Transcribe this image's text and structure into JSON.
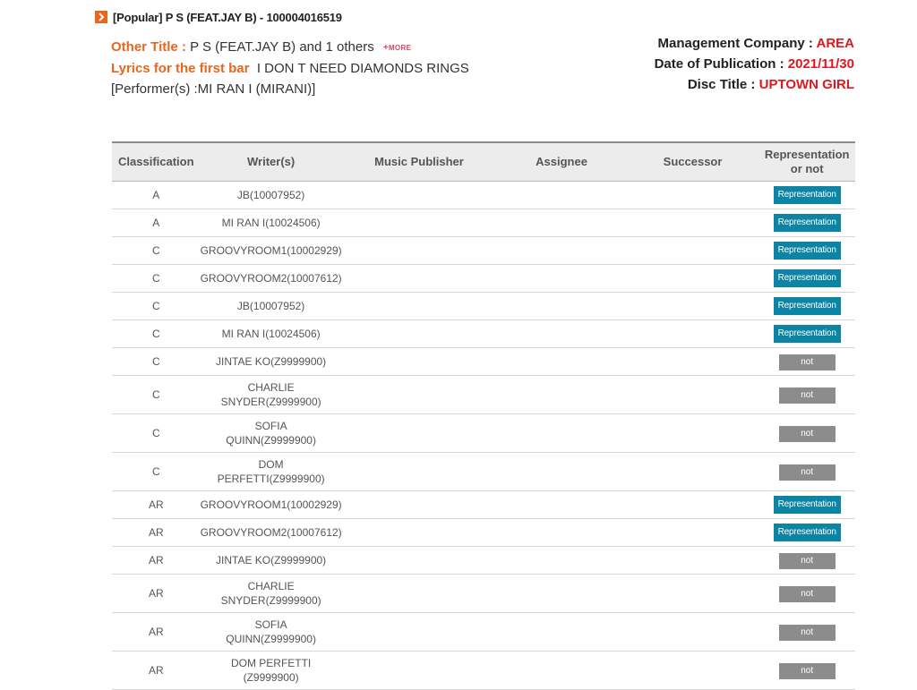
{
  "header": {
    "title_genre": "[Popular]",
    "title_song": "P S (FEAT.JAY B)",
    "title_sep": "-",
    "title_code": "100004016519"
  },
  "info": {
    "other_title_label": "Other Title :",
    "other_title_value": "P S (FEAT.JAY B) and 1 others",
    "more_label": "MORE",
    "lyrics_label": "Lyrics for the first bar",
    "lyrics_value": "I DON T NEED DIAMONDS RINGS",
    "performer": "[Performer(s) :MI RAN I (MIRANI)]"
  },
  "meta": {
    "management_label": "Management Company :",
    "management_value": "AREA",
    "publication_label": "Date of Publication :",
    "publication_value": "2021/11/30",
    "disc_label": "Disc Title :",
    "disc_value": "UPTOWN GIRL"
  },
  "table": {
    "headers": {
      "classification": "Classification",
      "writers": "Writer(s)",
      "publisher": "Music Publisher",
      "assignee": "Assignee",
      "successor": "Successor",
      "representation_line1": "Representation",
      "representation_line2": "or not"
    },
    "rows": [
      {
        "cls": "A",
        "w1": "JB(10007952)",
        "w2": "",
        "status": "Representation"
      },
      {
        "cls": "A",
        "w1": "MI RAN I(10024506)",
        "w2": "",
        "status": "Representation"
      },
      {
        "cls": "C",
        "w1": "GROOVYROOM1(10002929)",
        "w2": "",
        "status": "Representation"
      },
      {
        "cls": "C",
        "w1": "GROOVYROOM2(10007612)",
        "w2": "",
        "status": "Representation"
      },
      {
        "cls": "C",
        "w1": "JB(10007952)",
        "w2": "",
        "status": "Representation"
      },
      {
        "cls": "C",
        "w1": "MI RAN I(10024506)",
        "w2": "",
        "status": "Representation"
      },
      {
        "cls": "C",
        "w1": "JINTAE KO(Z9999900)",
        "w2": "",
        "status": "not"
      },
      {
        "cls": "C",
        "w1": "CHARLIE",
        "w2": "SNYDER(Z9999900)",
        "status": "not"
      },
      {
        "cls": "C",
        "w1": "SOFIA",
        "w2": "QUINN(Z9999900)",
        "status": "not"
      },
      {
        "cls": "C",
        "w1": "DOM",
        "w2": "PERFETTI(Z9999900)",
        "status": "not"
      },
      {
        "cls": "AR",
        "w1": "GROOVYROOM1(10002929)",
        "w2": "",
        "status": "Representation"
      },
      {
        "cls": "AR",
        "w1": "GROOVYROOM2(10007612)",
        "w2": "",
        "status": "Representation"
      },
      {
        "cls": "AR",
        "w1": "JINTAE KO(Z9999900)",
        "w2": "",
        "status": "not"
      },
      {
        "cls": "AR",
        "w1": "CHARLIE",
        "w2": "SNYDER(Z9999900)",
        "status": "not"
      },
      {
        "cls": "AR",
        "w1": "SOFIA",
        "w2": "QUINN(Z9999900)",
        "status": "not"
      },
      {
        "cls": "AR",
        "w1": "DOM PERFETTI",
        "w2": "(Z9999900)",
        "status": "not"
      }
    ]
  }
}
